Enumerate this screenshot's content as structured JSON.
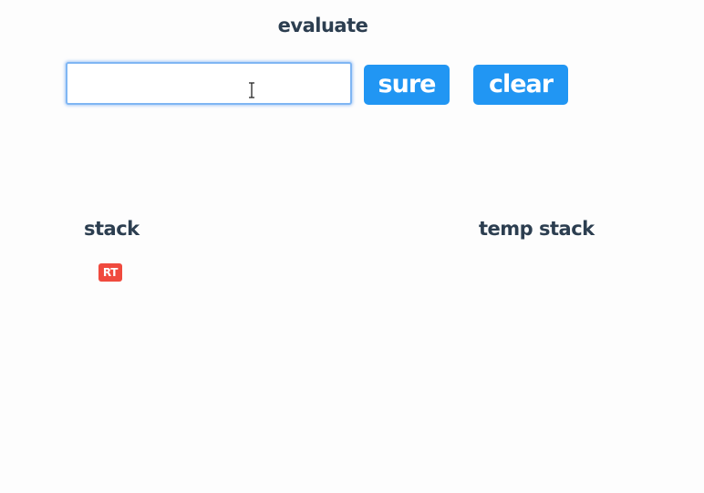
{
  "header": {
    "title": "evaluate"
  },
  "expression_input": {
    "value": "",
    "placeholder": ""
  },
  "buttons": {
    "sure_label": "sure",
    "clear_label": "clear"
  },
  "stack": {
    "label": "stack",
    "items": [
      "RT"
    ]
  },
  "temp_stack": {
    "label": "temp stack",
    "items": []
  },
  "colors": {
    "button_bg": "#2196f3",
    "button_text": "#ffffff",
    "badge_bg": "#f04a3e",
    "text": "#2c3e50",
    "input_focus_border": "#7fb6f3",
    "page_bg": "#fdfdfd"
  },
  "icons": {
    "cursor": "text-cursor-icon"
  }
}
